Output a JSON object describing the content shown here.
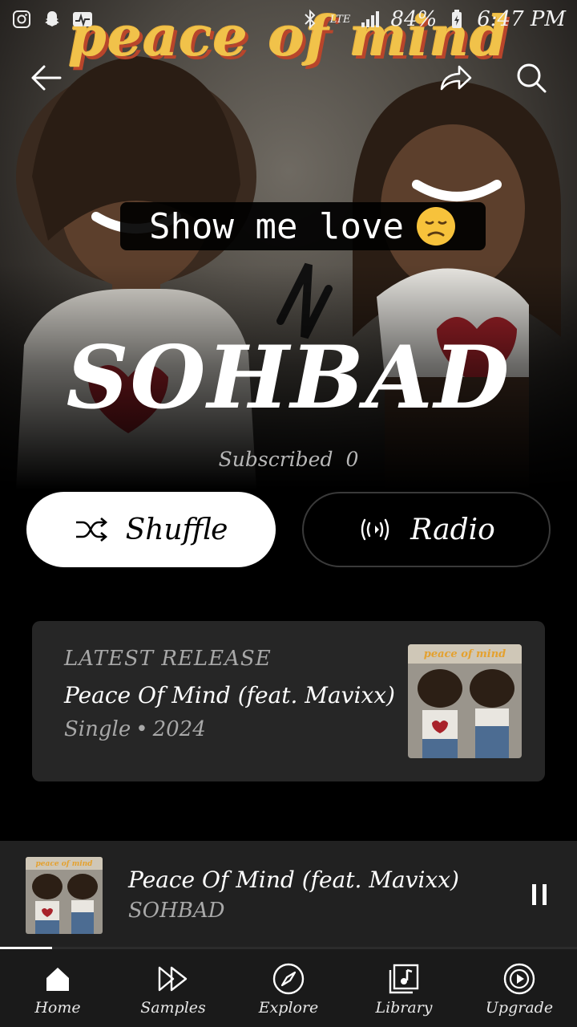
{
  "status_bar": {
    "battery": "84%",
    "time": "6:47 PM",
    "network": "LTE"
  },
  "hero": {
    "album_art_title": "peace of mind",
    "caption": "Show me love",
    "artist": "SOHBAD",
    "subscribed_label": "Subscribed",
    "subscribed_count": "0"
  },
  "actions": {
    "shuffle_label": "Shuffle",
    "radio_label": "Radio"
  },
  "latest_release": {
    "label": "LATEST RELEASE",
    "title": "Peace Of Mind (feat. Mavixx)",
    "type": "Single",
    "separator": "•",
    "year": "2024",
    "thumb_text": "peace of mind"
  },
  "mini_player": {
    "title": "Peace Of Mind (feat. Mavixx)",
    "artist": "SOHBAD",
    "thumb_text": "peace of mind",
    "progress": 0.09
  },
  "bottom_nav": {
    "items": [
      {
        "label": "Home",
        "icon": "home-icon"
      },
      {
        "label": "Samples",
        "icon": "samples-icon"
      },
      {
        "label": "Explore",
        "icon": "explore-icon"
      },
      {
        "label": "Library",
        "icon": "library-icon"
      },
      {
        "label": "Upgrade",
        "icon": "upgrade-icon"
      }
    ]
  },
  "colors": {
    "accent_yellow": "#f1c24a",
    "accent_red": "#b8452b",
    "card_bg": "#262626",
    "mini_player_bg": "#212121"
  }
}
